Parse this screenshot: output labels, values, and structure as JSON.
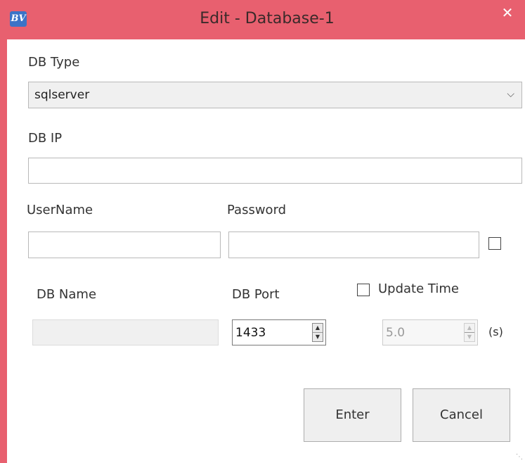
{
  "window": {
    "app_icon_text": "BV",
    "title": "Edit - Database-1",
    "close_glyph": "✕"
  },
  "form": {
    "db_type_label": "DB Type",
    "db_type_value": "sqlserver",
    "db_ip_label": "DB IP",
    "db_ip_value": "",
    "username_label": "UserName",
    "username_value": "",
    "password_label": "Password",
    "password_value": "",
    "show_password_checked": false,
    "db_name_label": "DB Name",
    "db_name_value": "",
    "db_port_label": "DB Port",
    "db_port_value": "1433",
    "update_time_label": "Update Time",
    "update_time_checked": false,
    "update_time_value": "5.0",
    "update_time_unit": "(s)"
  },
  "buttons": {
    "enter_label": "Enter",
    "cancel_label": "Cancel"
  },
  "icons": {
    "app": "bv-logo-icon",
    "close": "close-icon",
    "dropdown": "chevron-down-icon",
    "spin_up": "spin-up-icon",
    "spin_down": "spin-down-icon",
    "resize": "resize-grip-icon"
  },
  "colors": {
    "titlebar": "#e8606f",
    "client": "#ffffff"
  }
}
